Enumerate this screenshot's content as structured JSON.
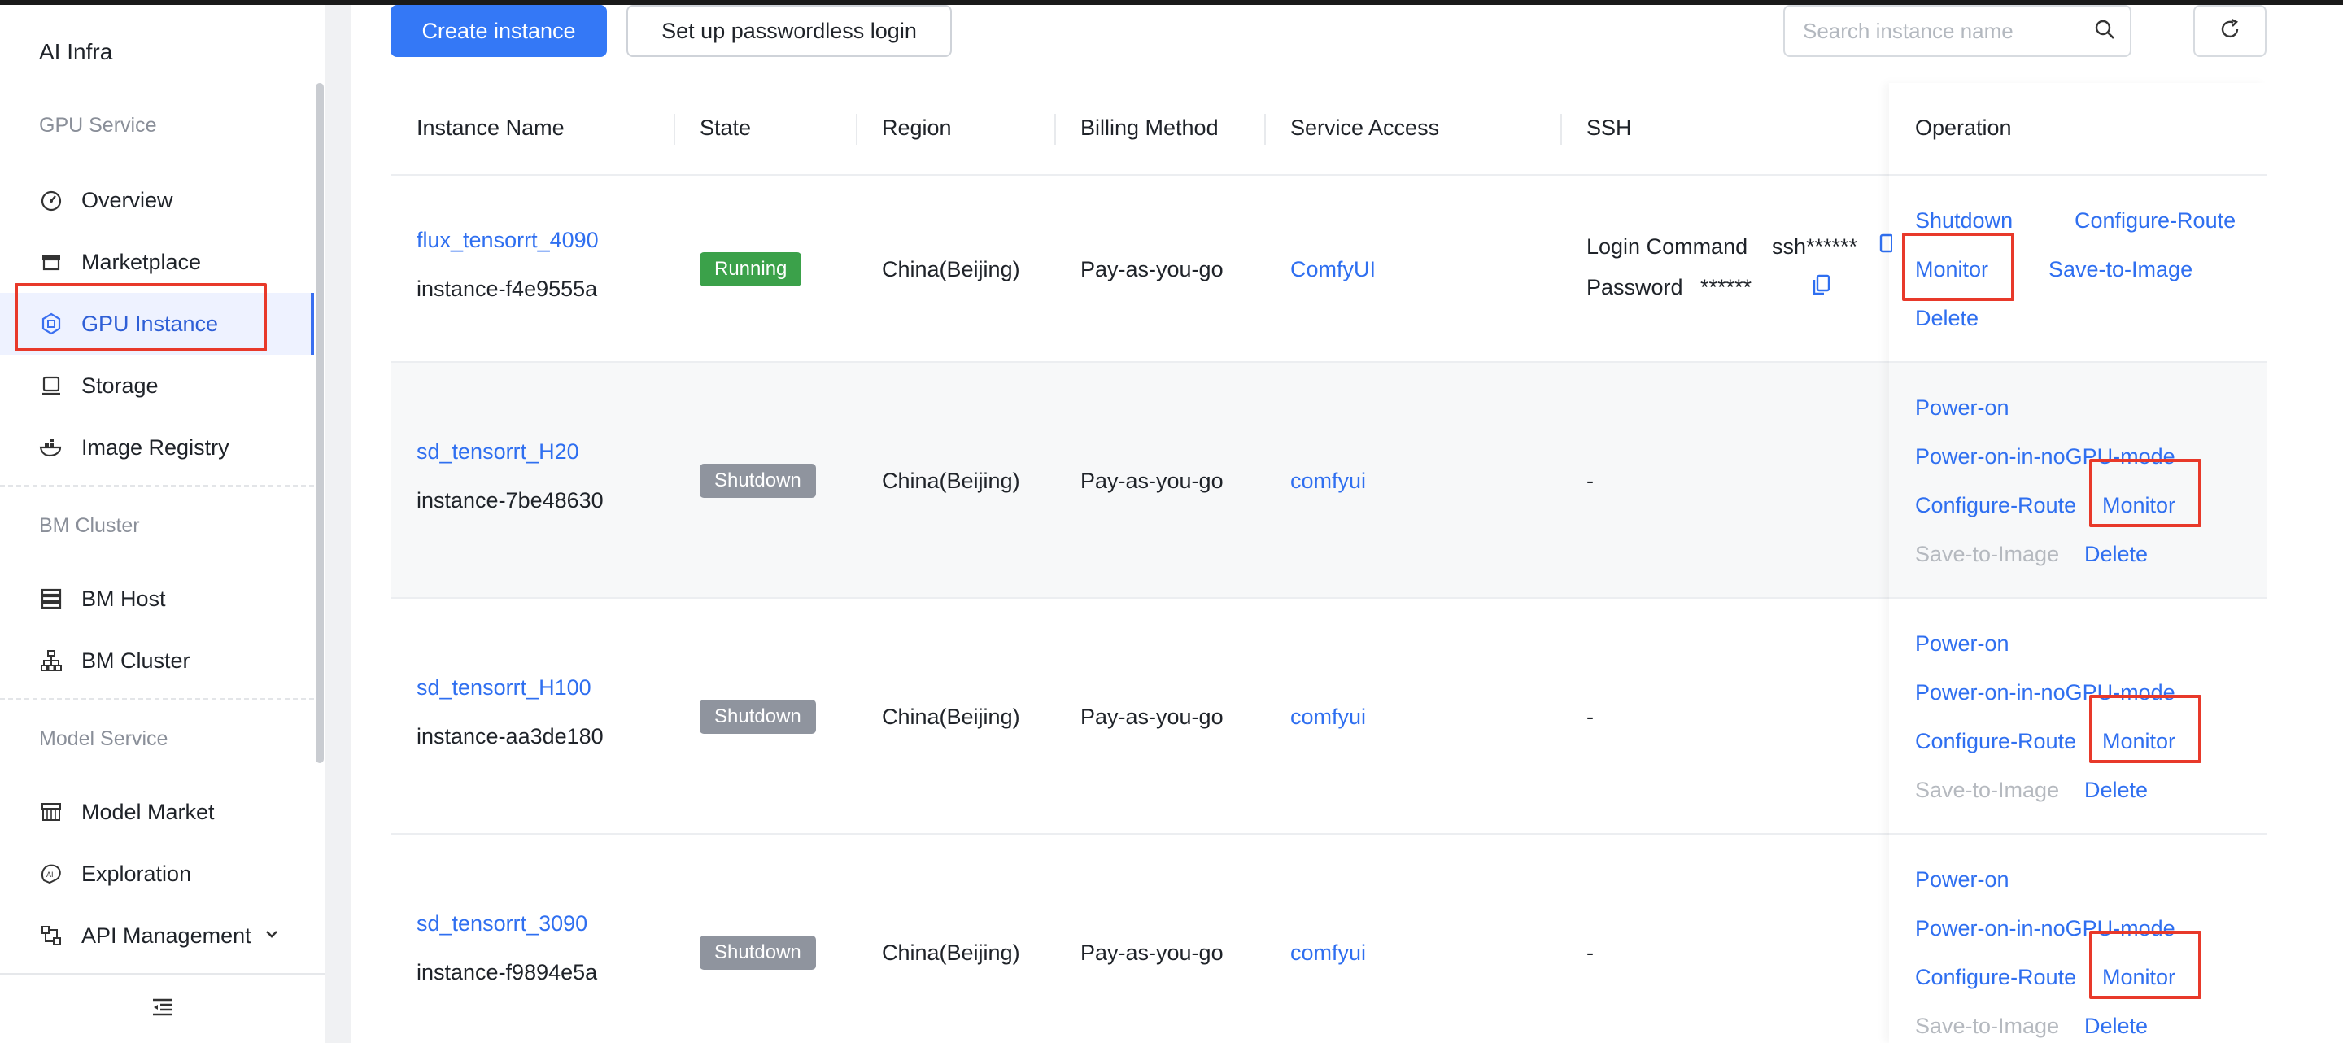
{
  "sidebar": {
    "brand": "AI Infra",
    "sections": [
      "GPU Service",
      "BM Cluster",
      "Model Service"
    ],
    "items": [
      {
        "label": "Overview",
        "icon": "dashboard-icon"
      },
      {
        "label": "Marketplace",
        "icon": "store-icon"
      },
      {
        "label": "GPU Instance",
        "icon": "gpu-chip-icon",
        "active": true
      },
      {
        "label": "Storage",
        "icon": "storage-icon"
      },
      {
        "label": "Image Registry",
        "icon": "container-registry-icon"
      },
      {
        "label": "BM Host",
        "icon": "server-icon"
      },
      {
        "label": "BM Cluster",
        "icon": "cluster-icon"
      },
      {
        "label": "Model Market",
        "icon": "model-market-icon"
      },
      {
        "label": "Exploration",
        "icon": "ai-exploration-icon"
      },
      {
        "label": "API Management",
        "icon": "api-icon"
      }
    ]
  },
  "toolbar": {
    "create_label": "Create instance",
    "passwordless_label": "Set up passwordless login",
    "search_placeholder": "Search instance name"
  },
  "table": {
    "columns": [
      "Instance Name",
      "State",
      "Region",
      "Billing Method",
      "Service Access",
      "SSH",
      "Operation"
    ],
    "rows": [
      {
        "name": "flux_tensorrt_4090",
        "id": "instance-f4e9555a",
        "state": "Running",
        "region": "China(Beijing)",
        "billing": "Pay-as-you-go",
        "service": "ComfyUI",
        "ssh_login_label": "Login Command",
        "ssh_login_value": "ssh******",
        "ssh_password_label": "Password",
        "ssh_password_value": "******",
        "ops": [
          "Shutdown",
          "Configure-Route",
          "Monitor",
          "Save-to-Image",
          "Delete"
        ]
      },
      {
        "name": "sd_tensorrt_H20",
        "id": "instance-7be48630",
        "state": "Shutdown",
        "region": "China(Beijing)",
        "billing": "Pay-as-you-go",
        "service": "comfyui",
        "ssh": "-",
        "ops": [
          "Power-on",
          "Power-on-in-noGPU-mode",
          "Configure-Route",
          "Monitor",
          "Save-to-Image",
          "Delete"
        ]
      },
      {
        "name": "sd_tensorrt_H100",
        "id": "instance-aa3de180",
        "state": "Shutdown",
        "region": "China(Beijing)",
        "billing": "Pay-as-you-go",
        "service": "comfyui",
        "ssh": "-",
        "ops": [
          "Power-on",
          "Power-on-in-noGPU-mode",
          "Configure-Route",
          "Monitor",
          "Save-to-Image",
          "Delete"
        ]
      },
      {
        "name": "sd_tensorrt_3090",
        "id": "instance-f9894e5a",
        "state": "Shutdown",
        "region": "China(Beijing)",
        "billing": "Pay-as-you-go",
        "service": "comfyui",
        "ssh": "-",
        "ops": [
          "Power-on",
          "Power-on-in-noGPU-mode",
          "Configure-Route",
          "Monitor",
          "Save-to-Image",
          "Delete"
        ]
      }
    ]
  },
  "colors": {
    "primary": "#3478f6",
    "link": "#2f6ff0",
    "running": "#3ba14a",
    "shutdown": "#8f949e",
    "highlight": "#e8392a"
  }
}
